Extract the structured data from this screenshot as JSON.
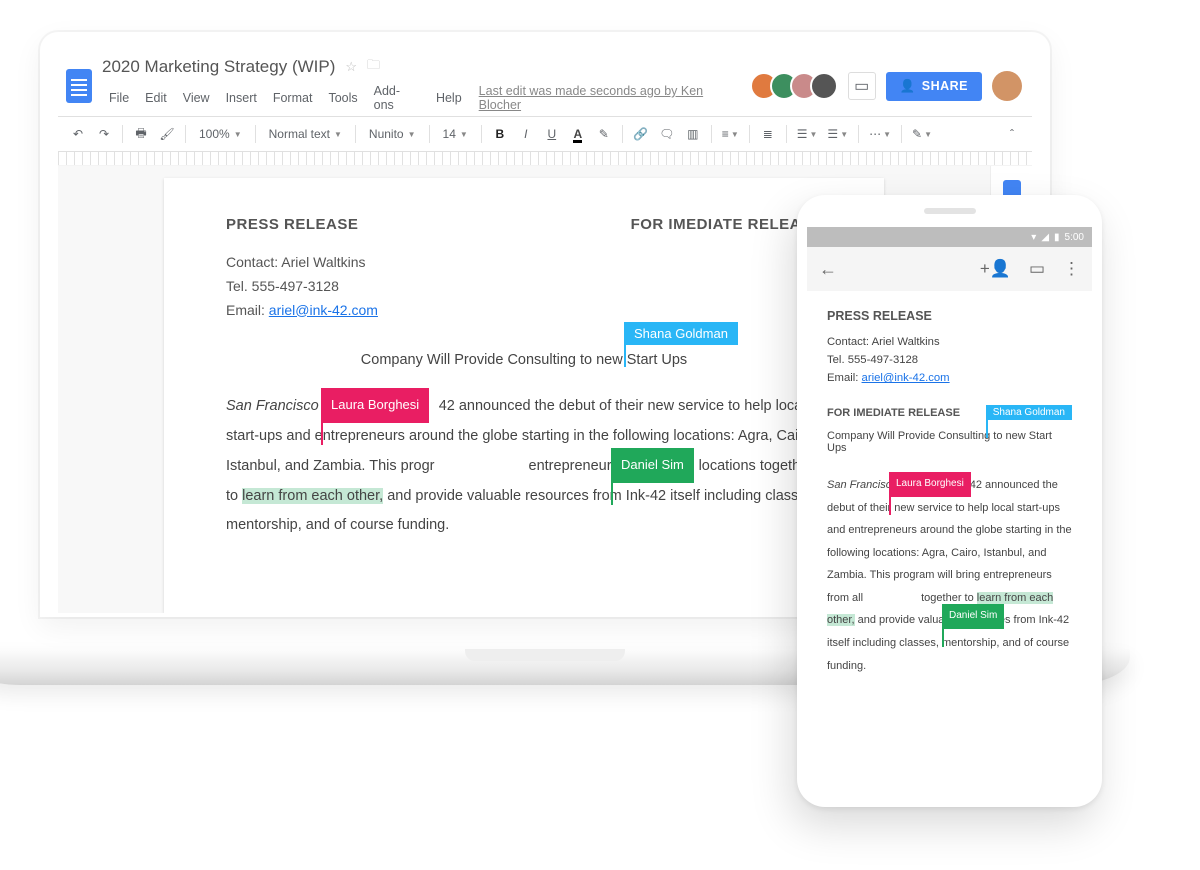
{
  "doc": {
    "title": "2020 Marketing Strategy (WIP)",
    "menu": [
      "File",
      "Edit",
      "View",
      "Insert",
      "Format",
      "Tools",
      "Add-ons",
      "Help"
    ],
    "last_edit": "Last edit was made seconds ago by Ken Blocher",
    "share": "SHARE",
    "tb": {
      "zoom": "100%",
      "style": "Normal text",
      "font": "Nunito",
      "size": "14"
    }
  },
  "collaborators": {
    "c1": "Shana Goldman",
    "c2": "Laura Borghesi",
    "c3": "Daniel Sim"
  },
  "content": {
    "press": "PRESS RELEASE",
    "imm": "FOR IMEDIATE RELEASE",
    "contact_name": "Contact: Ariel Waltkins",
    "tel": "Tel. 555-497-3128",
    "email_label": "Email: ",
    "email": "ariel@ink-42.com",
    "subtitle_a": "Company Will Provide Consulting",
    "subtitle_b": " to new Start Ups",
    "p1a": "San Francisco",
    "p1b": "42 announced the debut of their new service to help local start-ups and entrepreneurs around the globe starting in the following locations: Agra, Cairo, Istanbul, and Zambia. This progr",
    "p1c": " entrepreneurs from all the locations together to ",
    "p1d": "learn from each other,",
    "p1e": " and provide valuable resources from Ink-42 itself including classes, mentorship, and of course funding."
  },
  "phone": {
    "time": "5:00",
    "body_a": "San Francisc",
    "body_b": "k 42 announced the debut of their new service to help local start-ups and entrepreneurs around the globe starting in the following locations: Agra, Cairo, Istanbul, and Zambia. This program will bring entrepreneurs from all ",
    "body_c": "together to ",
    "body_d": "learn from each other,",
    "body_e": " and provide valuable resources from Ink-42 itself including classes, mentorship, and of course funding."
  }
}
